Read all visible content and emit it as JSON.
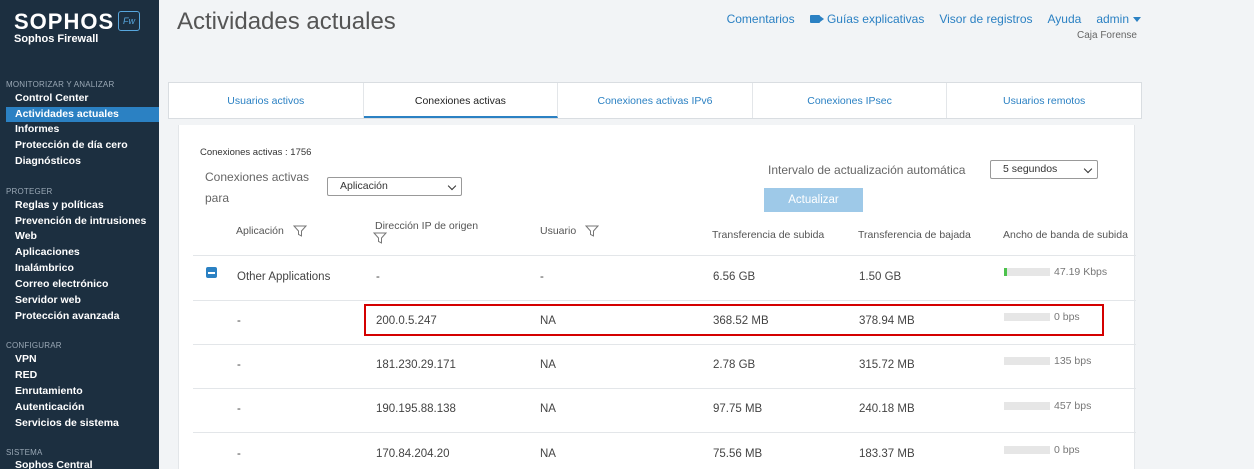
{
  "brand": {
    "name": "SOPHOS",
    "product": "Sophos Firewall",
    "badge": "Fw"
  },
  "sidebar": {
    "sections": [
      {
        "title": "MONITORIZAR Y ANALIZAR",
        "items": [
          "Control Center",
          "Actividades actuales",
          "Informes",
          "Protección de día cero",
          "Diagnósticos"
        ]
      },
      {
        "title": "PROTEGER",
        "items": [
          "Reglas y políticas",
          "Prevención de intrusiones",
          "Web",
          "Aplicaciones",
          "Inalámbrico",
          "Correo electrónico",
          "Servidor web",
          "Protección avanzada"
        ]
      },
      {
        "title": "CONFIGURAR",
        "items": [
          "VPN",
          "RED",
          "Enrutamiento",
          "Autenticación",
          "Servicios de sistema"
        ]
      },
      {
        "title": "SISTEMA",
        "items": [
          "Sophos Central"
        ]
      }
    ],
    "active": "Actividades actuales"
  },
  "header": {
    "title": "Actividades actuales",
    "links": {
      "comments": "Comentarios",
      "guides": "Guías explicativas",
      "logs": "Visor de registros",
      "help": "Ayuda",
      "user": "admin"
    },
    "org": "Caja Forense"
  },
  "tabs": [
    "Usuarios activos",
    "Conexiones activas",
    "Conexiones activas IPv6",
    "Conexiones IPsec",
    "Usuarios remotos"
  ],
  "active_tab": "Conexiones activas",
  "controls": {
    "count": "Conexiones activas : 1756",
    "for_label": "Conexiones activas para",
    "for_value": "Aplicación",
    "interval_label": "Intervalo de actualización automática",
    "interval_value": "5 segundos",
    "refresh": "Actualizar"
  },
  "table": {
    "headers": [
      "Aplicación",
      "Dirección IP de origen",
      "Usuario",
      "Transferencia de subida",
      "Transferencia de bajada",
      "Ancho de banda de subida"
    ],
    "rows": [
      {
        "app": "Other Applications",
        "ip": "-",
        "user": "-",
        "up": "6.56 GB",
        "down": "1.50 GB",
        "bw": "47.19 Kbps",
        "fill": 0.06,
        "group": true
      },
      {
        "app": "-",
        "ip": "200.0.5.247",
        "user": "NA",
        "up": "368.52 MB",
        "down": "378.94 MB",
        "bw": "0 bps",
        "fill": 0
      },
      {
        "app": "-",
        "ip": "181.230.29.171",
        "user": "NA",
        "up": "2.78 GB",
        "down": "315.72 MB",
        "bw": "135 bps",
        "fill": 0
      },
      {
        "app": "-",
        "ip": "190.195.88.138",
        "user": "NA",
        "up": "97.75 MB",
        "down": "240.18 MB",
        "bw": "457 bps",
        "fill": 0
      },
      {
        "app": "-",
        "ip": "170.84.204.20",
        "user": "NA",
        "up": "75.56 MB",
        "down": "183.37 MB",
        "bw": "0 bps",
        "fill": 0
      }
    ]
  }
}
